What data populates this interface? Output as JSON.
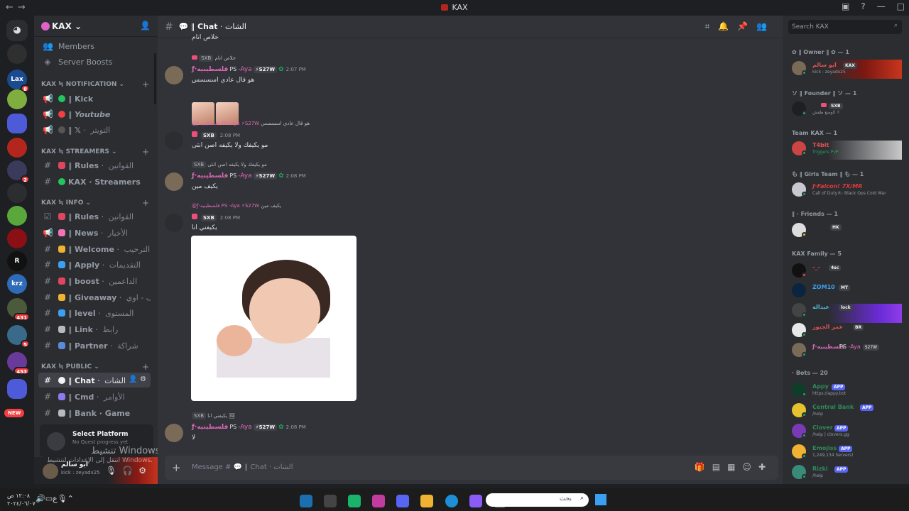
{
  "titlebar": {
    "title": "KAX"
  },
  "server": {
    "name": "KAX",
    "ui_colors": {
      "bg": "#313338",
      "sidebar": "#2b2d31",
      "accent": "#5865f2",
      "name_pink": "#e068b8"
    }
  },
  "guild_badges": {
    "g1": "8",
    "g2": "2",
    "g3": "431",
    "g4": "5",
    "g5": "453",
    "new_label": "NEW"
  },
  "sidebar": {
    "members_label": "Members",
    "boosts_label": "Server Boosts",
    "categories": {
      "notification": "KAX ≒ NOTIFICATION",
      "streamers": "KAX ≒ STREAMERS",
      "info": "KAX ≒ INFO",
      "public": "KAX ≒ PUBLIC"
    },
    "channels": {
      "kick": {
        "title": "Kick",
        "arabic": ""
      },
      "youtube": {
        "title": "Youtube",
        "arabic": ""
      },
      "x": {
        "title": "𝕏",
        "arabic": "التويتر"
      },
      "rules1": {
        "title": "Rules",
        "arabic": "القوانين"
      },
      "kax_streamers": {
        "title": "KAX · Streamers",
        "arabic": ""
      },
      "rules2": {
        "title": "Rules",
        "arabic": "القوانين"
      },
      "news": {
        "title": "News",
        "arabic": "الأخبار"
      },
      "welcome": {
        "title": "Welcome",
        "arabic": "الترحيب"
      },
      "apply": {
        "title": "Apply",
        "arabic": "التقديمات"
      },
      "boost": {
        "title": "boost",
        "arabic": "الداعمين"
      },
      "giveaway": {
        "title": "Giveaway",
        "arabic": "قيف - اوي"
      },
      "level": {
        "title": "level",
        "arabic": "المستوى"
      },
      "link": {
        "title": "Link",
        "arabic": "رابط"
      },
      "partner": {
        "title": "Partner",
        "arabic": "شراكة"
      },
      "chat": {
        "title": "Chat",
        "arabic": "الشات"
      },
      "cmd": {
        "title": "Cmd",
        "arabic": "الأوامر"
      },
      "bank": {
        "title": "Bank · Game",
        "arabic": ""
      }
    }
  },
  "quest": {
    "title": "Select Platform",
    "subtitle": "No Quest progress yet"
  },
  "user_panel": {
    "name": "ابو سالم",
    "status": "kick : zeyadx25"
  },
  "watermark": {
    "line1": "تنشيط Windows",
    "line2": "انتقل إلى الإعدادات لتنشيط Windows."
  },
  "header": {
    "channel_title": "Chat",
    "channel_arabic": "الشات"
  },
  "messages": {
    "m0": {
      "text": "خلاص انام"
    },
    "m1": {
      "reply": "خلاص انام",
      "author": "ƒ·فلسطينيه",
      "ps": "PS",
      "aya": "-Aya",
      "tag": "⚡S27W",
      "time": "2:07 PM",
      "text": "هو قال عادي اسسسس"
    },
    "m2": {
      "reply": "هو قال عادي اسسسس",
      "reply_author": "@ƒ·فلسطينيه PS -Aya ⚡S27W",
      "tag": "SXB",
      "time": "2:08 PM",
      "text": "مو يكيفك ولا يكيفه اصن انثى"
    },
    "m3": {
      "reply": "مو يكيفك ولا يكيفه اصن انثى",
      "author": "ƒ·فلسطينيه",
      "ps": "PS",
      "aya": "-Aya",
      "tag": "⚡S27W",
      "time": "2:08 PM",
      "text": "يكيف مين"
    },
    "m4": {
      "reply": "يكيف مين",
      "reply_author": "@ƒ·فلسطينيه PS -Aya ⚡S27W",
      "tag": "SXB",
      "time": "2:08 PM",
      "text": "يكيفني انا"
    },
    "m5": {
      "reply": "يكيفني انا",
      "author": "ƒ·فلسطينيه",
      "ps": "PS",
      "aya": "-Aya",
      "tag": "⚡S27W",
      "time": "2:08 PM",
      "text": "لا"
    }
  },
  "composer": {
    "placeholder": "Message # 💬 ‖ Chat · الشات"
  },
  "members": {
    "search_placeholder": "Search KAX",
    "cats": {
      "owner": "✿ ‖ Owner ‖ ✿ — 1",
      "founder": "ソ ‖ Founder ‖ ソ — 1",
      "team": "Team KAX — 1",
      "girls": "も ‖ Girls Team ‖ も — 1",
      "friends": "‖ · Friends — 1",
      "family": "KAX Family — 5",
      "bots": "· Bots — 20"
    },
    "list": {
      "owner": {
        "name": "ابو سالم",
        "tag": "KAX",
        "sub": "kick : zeyadx25"
      },
      "founder": {
        "name": "",
        "tag": "SXB",
        "sub": "الوضع طفش ✌"
      },
      "team": {
        "name": "T4bit",
        "tag": "",
        "sub": "Triggers PvP"
      },
      "girls": {
        "name": "ƒ·Falcon! 7X/MR",
        "tag": "",
        "sub": "Call of Duty®: Black Ops Cold War"
      },
      "friends": {
        "name": "",
        "tag": "HK",
        "sub": ""
      },
      "f1": {
        "name": "-_-",
        "tag": "4sc",
        "sub": ""
      },
      "f2": {
        "name": "ZOM10",
        "tag": "MT",
        "sub": ""
      },
      "f3": {
        "name": "عبداله",
        "tag": "lock",
        "sub": ""
      },
      "f4": {
        "name": "عمر الجبور",
        "tag": "BR",
        "sub": ""
      },
      "f5": {
        "name": "ƒ·فلسطينيه",
        "tag": "S27W",
        "sub": "",
        "ps": "PS",
        "aya": "-Aya"
      },
      "b1": {
        "name": "Appy",
        "tag": "APP",
        "sub": "https://appy.bot"
      },
      "b2": {
        "name": "Central Bank",
        "tag": "APP",
        "sub": "/help"
      },
      "b3": {
        "name": "Clover",
        "tag": "APP",
        "sub": "/help | clovers.gg"
      },
      "b4": {
        "name": "Emojiss",
        "tag": "APP",
        "sub": "1,249,134 Servers!"
      },
      "b5": {
        "name": "Rizki",
        "tag": "APP",
        "sub": "/help"
      }
    }
  },
  "taskbar": {
    "time": "١٢:٠٨ ص",
    "date": "٢٠٢٤/٠٦/٠٧",
    "lang": "ع",
    "search_placeholder": "بحث"
  }
}
